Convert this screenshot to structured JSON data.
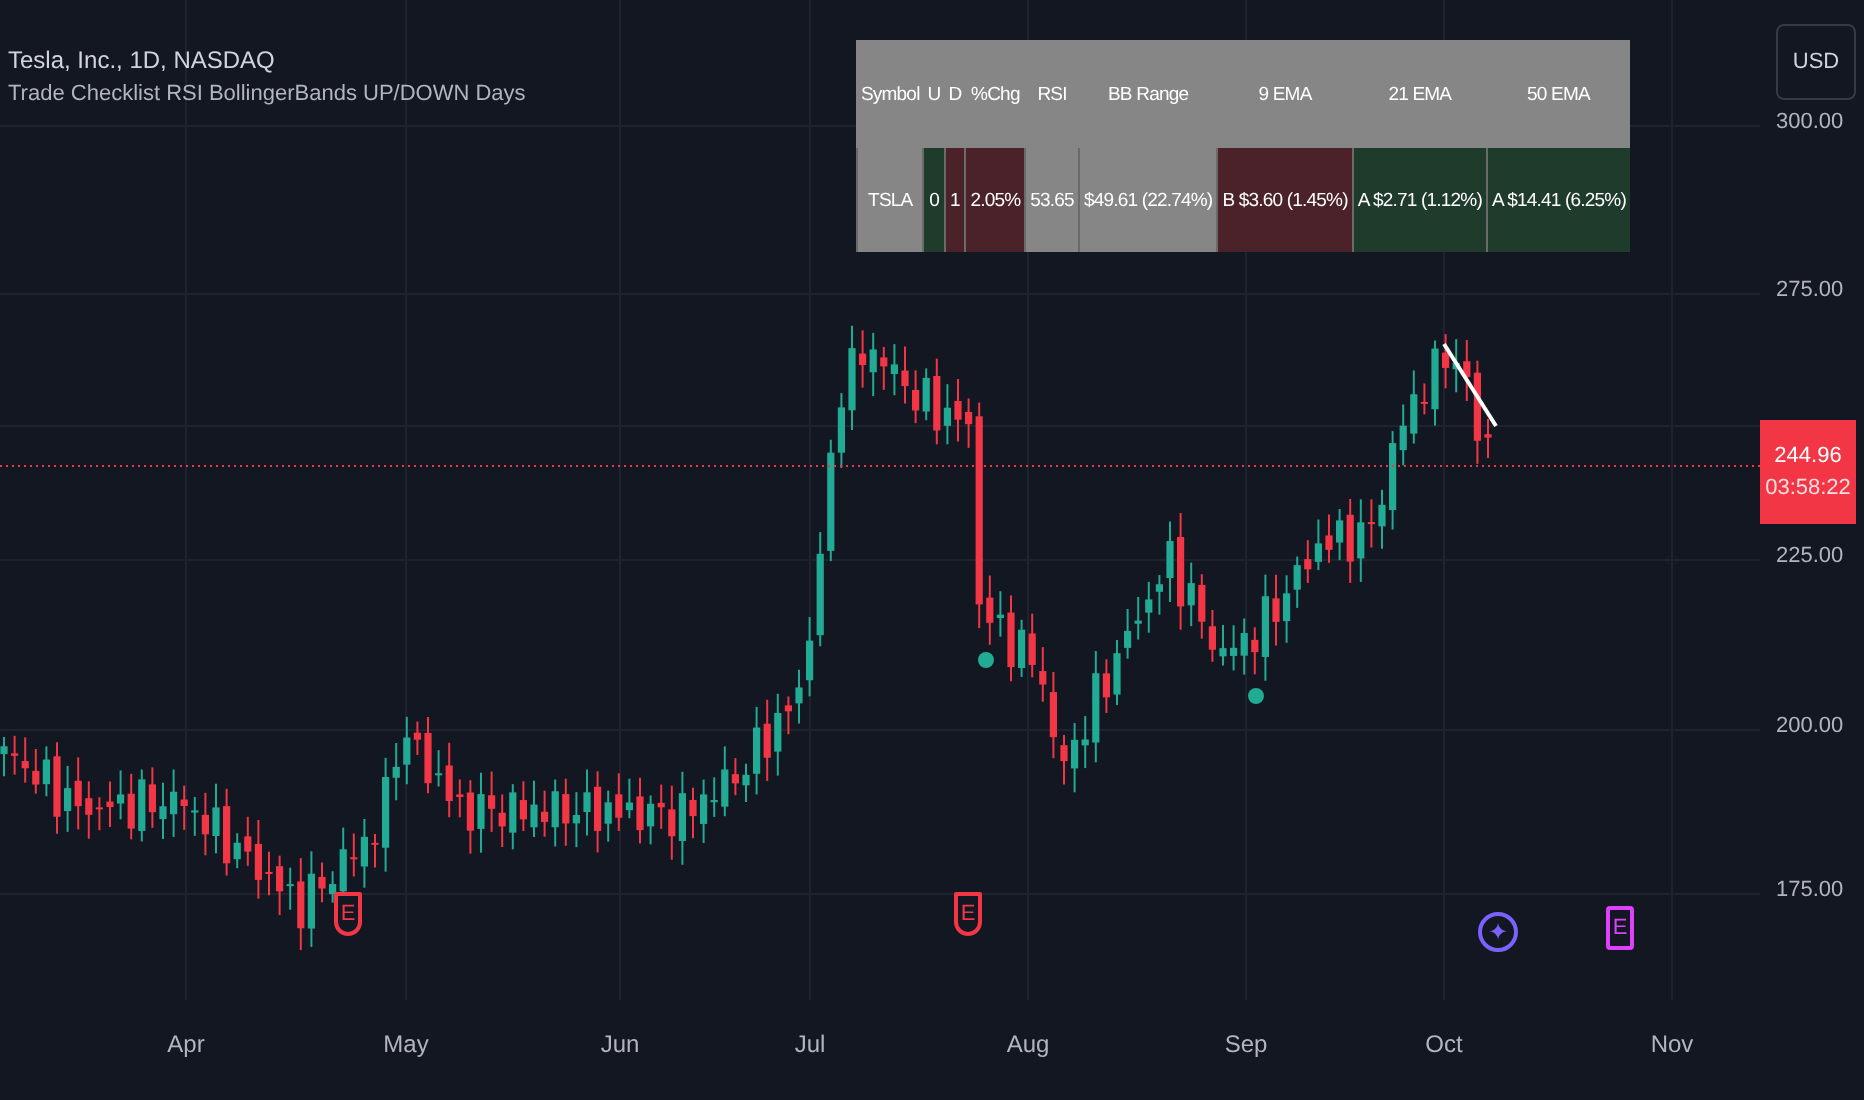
{
  "legend": {
    "title": "Tesla, Inc., 1D, NASDAQ",
    "indicator": "Trade Checklist RSI BollingerBands UP/DOWN Days"
  },
  "currency_button": "USD",
  "checklist_table": {
    "columns": [
      "Symbol",
      "U",
      "D",
      "%Chg",
      "RSI",
      "BB Range",
      "9 EMA",
      "21 EMA",
      "50 EMA"
    ],
    "row": [
      {
        "text": "TSLA",
        "color": "#868686"
      },
      {
        "text": "0",
        "color": "#1f3b2c"
      },
      {
        "text": "1",
        "color": "#4b2229"
      },
      {
        "text": "2.05%",
        "color": "#4b2229"
      },
      {
        "text": "53.65",
        "color": "#868686"
      },
      {
        "text": "$49.61 (22.74%)",
        "color": "#868686"
      },
      {
        "text": "B $3.60 (1.45%)",
        "color": "#4b2229"
      },
      {
        "text": "A $2.71 (1.12%)",
        "color": "#1f3b2c"
      },
      {
        "text": "A $14.41 (6.25%)",
        "color": "#1f3b2c"
      }
    ]
  },
  "price_axis": {
    "labels": [
      "300.00",
      "275.00",
      "225.00",
      "200.00",
      "175.00"
    ],
    "last_price": "244.96",
    "countdown": "03:58:22"
  },
  "time_axis": {
    "labels": [
      "Apr",
      "May",
      "Jun",
      "Jul",
      "Aug",
      "Sep",
      "Oct",
      "Nov"
    ]
  },
  "event_markers": [
    {
      "kind": "earnings",
      "text": "E",
      "color": "#f23645"
    },
    {
      "kind": "earnings",
      "text": "E",
      "color": "#f23645"
    },
    {
      "kind": "event",
      "text": "✦",
      "color": "#7b61ff"
    },
    {
      "kind": "earnings-upcoming",
      "text": "E",
      "color": "#e040fb"
    }
  ]
}
